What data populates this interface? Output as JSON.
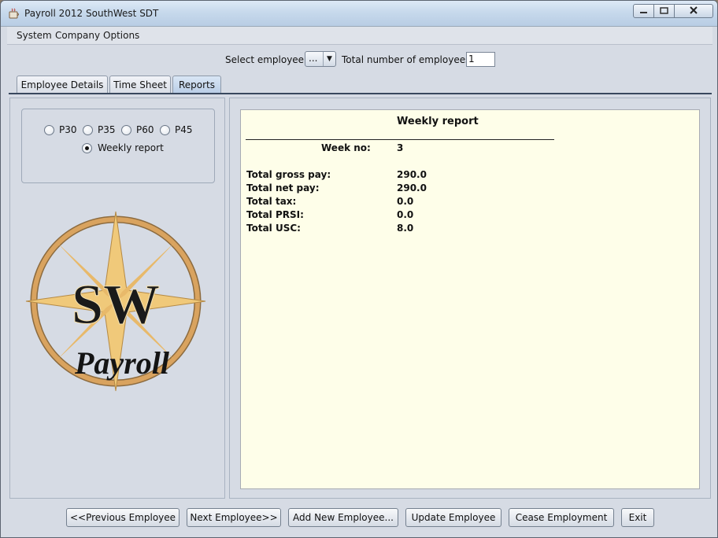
{
  "window": {
    "title": "Payroll 2012 SouthWest SDT",
    "controls": {
      "minimize_icon": "minimize-icon",
      "maximize_icon": "maximize-icon",
      "close_icon": "close-icon"
    }
  },
  "menubar": {
    "items": [
      {
        "label": "System"
      },
      {
        "label": "Company"
      },
      {
        "label": "Options"
      }
    ]
  },
  "topbar": {
    "select_employee_label": "Select employee:",
    "select_employee_value": "...",
    "total_employees_label": "Total number of employees:",
    "total_employees_value": "1"
  },
  "tabs": [
    {
      "label": "Employee Details"
    },
    {
      "label": "Time Sheet"
    },
    {
      "label": "Reports",
      "active": true
    }
  ],
  "report_options": [
    {
      "label": "P30",
      "selected": false
    },
    {
      "label": "P35",
      "selected": false
    },
    {
      "label": "P60",
      "selected": false
    },
    {
      "label": "P45",
      "selected": false
    },
    {
      "label": "Weekly report",
      "selected": true
    }
  ],
  "logo": {
    "letters": "SW",
    "word": "Payroll"
  },
  "report": {
    "title": "Weekly report",
    "week_label": "Week no:",
    "week_value": "3",
    "rows": [
      {
        "label": "Total gross pay:",
        "value": "290.0"
      },
      {
        "label": "Total net pay:",
        "value": "290.0"
      },
      {
        "label": "Total tax:",
        "value": "0.0"
      },
      {
        "label": "Total PRSI:",
        "value": "0.0"
      },
      {
        "label": "Total USC:",
        "value": "8.0"
      }
    ]
  },
  "buttons": [
    {
      "label": "<<Previous Employee"
    },
    {
      "label": "Next Employee>>"
    },
    {
      "label": "Add New Employee..."
    },
    {
      "label": "Update Employee"
    },
    {
      "label": "Cease Employment"
    },
    {
      "label": "Exit"
    }
  ],
  "colors": {
    "report_background": "#fefee9",
    "window_background": "#d6dbe4",
    "title_accent": "#b8cde4"
  }
}
